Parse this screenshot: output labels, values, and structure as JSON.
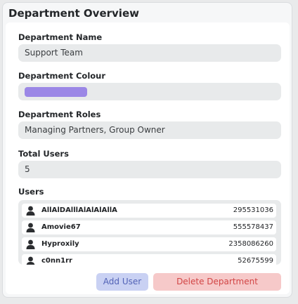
{
  "panel": {
    "title": "Department Overview"
  },
  "fields": {
    "name": {
      "label": "Department Name",
      "value": "Support Team"
    },
    "colour": {
      "label": "Department Colour",
      "swatch_color": "#9b87e6"
    },
    "roles": {
      "label": "Department Roles",
      "value": "Managing Partners, Group Owner"
    },
    "total_users": {
      "label": "Total Users",
      "value": "5"
    }
  },
  "users": {
    "label": "Users",
    "rows": [
      {
        "name": "AllAlDAlllAlAlAlAllA",
        "id": "295531036"
      },
      {
        "name": "Amovie67",
        "id": "555578437"
      },
      {
        "name": "Hyproxily",
        "id": "2358086260"
      },
      {
        "name": "c0nn1rr",
        "id": "52675599"
      }
    ]
  },
  "actions": {
    "add_user": "Add User",
    "delete_department": "Delete Department"
  },
  "colors": {
    "add_user_bg": "#c9d1f3",
    "add_user_text": "#5162b6",
    "delete_bg": "#f6c9c9",
    "delete_text": "#d24545"
  }
}
